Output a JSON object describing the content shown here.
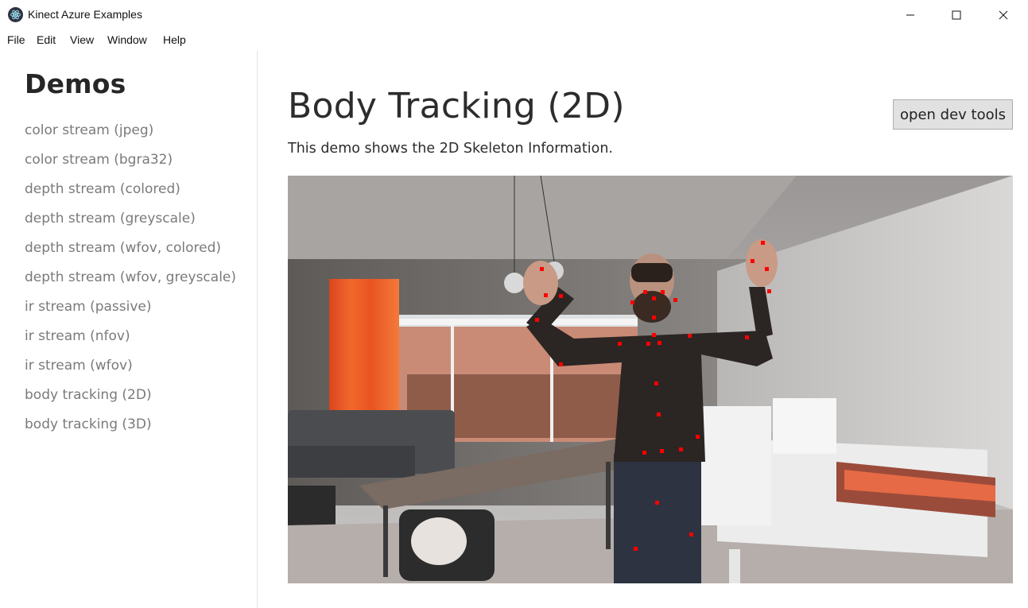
{
  "window": {
    "title": "Kinect Azure Examples",
    "controls": [
      "minimize",
      "maximize",
      "close"
    ]
  },
  "menu": [
    "File",
    "Edit",
    "View",
    "Window",
    "Help"
  ],
  "sidebar": {
    "title": "Demos",
    "items": [
      "color stream (jpeg)",
      "color stream (bgra32)",
      "depth stream (colored)",
      "depth stream (greyscale)",
      "depth stream (wfov, colored)",
      "depth stream (wfov, greyscale)",
      "ir stream (passive)",
      "ir stream (nfov)",
      "ir stream (wfov)",
      "body tracking (2D)",
      "body tracking (3D)"
    ]
  },
  "main": {
    "title": "Body Tracking (2D)",
    "subtitle": "This demo shows the 2D Skeleton Information.",
    "devtools_button": "open dev tools"
  },
  "colors": {
    "joint": "#ff0000",
    "accent": "#e1e1e1"
  }
}
